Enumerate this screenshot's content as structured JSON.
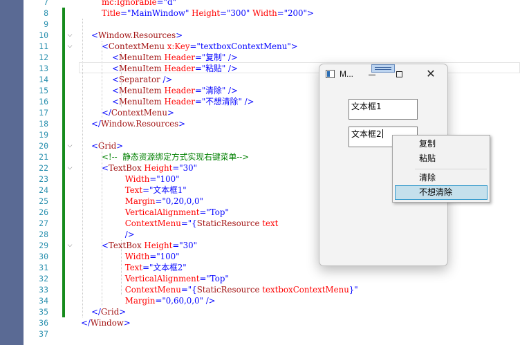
{
  "editor": {
    "line_numbers": [
      "7",
      "8",
      "9",
      "10",
      "11",
      "12",
      "13",
      "14",
      "15",
      "16",
      "17",
      "18",
      "19",
      "20",
      "21",
      "22",
      "23",
      "24",
      "25",
      "26",
      "27",
      "28",
      "29",
      "30",
      "31",
      "32",
      "33",
      "34",
      "35",
      "36",
      "37"
    ],
    "lines": [
      {
        "num": "7",
        "segments": [
          {
            "t": "        ",
            "c": ""
          },
          {
            "t": "mc:Ignorable",
            "c": "attr"
          },
          {
            "t": "=\"d\"",
            "c": "val"
          }
        ]
      },
      {
        "num": "8",
        "segments": [
          {
            "t": "        ",
            "c": ""
          },
          {
            "t": "Title",
            "c": "attr"
          },
          {
            "t": "=\"MainWindow\" ",
            "c": "val"
          },
          {
            "t": "Height",
            "c": "attr"
          },
          {
            "t": "=\"300\" ",
            "c": "val"
          },
          {
            "t": "Width",
            "c": "attr"
          },
          {
            "t": "=\"200\">",
            "c": "val"
          }
        ]
      },
      {
        "num": "9",
        "segments": []
      },
      {
        "num": "10",
        "segments": [
          {
            "t": "    ",
            "c": ""
          },
          {
            "t": "<",
            "c": "bracket"
          },
          {
            "t": "Window.Resources",
            "c": "tag"
          },
          {
            "t": ">",
            "c": "bracket"
          }
        ]
      },
      {
        "num": "11",
        "segments": [
          {
            "t": "        ",
            "c": ""
          },
          {
            "t": "<",
            "c": "bracket"
          },
          {
            "t": "ContextMenu ",
            "c": "tag"
          },
          {
            "t": "x:Key",
            "c": "attr"
          },
          {
            "t": "=\"textboxContextMenu\">",
            "c": "val"
          }
        ]
      },
      {
        "num": "12",
        "segments": [
          {
            "t": "            ",
            "c": ""
          },
          {
            "t": "<",
            "c": "bracket"
          },
          {
            "t": "MenuItem ",
            "c": "tag"
          },
          {
            "t": "Header",
            "c": "attr"
          },
          {
            "t": "=\"复制\" />",
            "c": "val"
          }
        ]
      },
      {
        "num": "13",
        "segments": [
          {
            "t": "            ",
            "c": ""
          },
          {
            "t": "<",
            "c": "bracket"
          },
          {
            "t": "MenuItem ",
            "c": "tag"
          },
          {
            "t": "Header",
            "c": "attr"
          },
          {
            "t": "=\"粘贴\" />",
            "c": "val"
          }
        ]
      },
      {
        "num": "14",
        "segments": [
          {
            "t": "            ",
            "c": ""
          },
          {
            "t": "<",
            "c": "bracket"
          },
          {
            "t": "Separator",
            "c": "tag"
          },
          {
            "t": " />",
            "c": "bracket"
          }
        ]
      },
      {
        "num": "15",
        "segments": [
          {
            "t": "            ",
            "c": ""
          },
          {
            "t": "<",
            "c": "bracket"
          },
          {
            "t": "MenuItem ",
            "c": "tag"
          },
          {
            "t": "Header",
            "c": "attr"
          },
          {
            "t": "=\"清除\" />",
            "c": "val"
          }
        ]
      },
      {
        "num": "16",
        "segments": [
          {
            "t": "            ",
            "c": ""
          },
          {
            "t": "<",
            "c": "bracket"
          },
          {
            "t": "MenuItem ",
            "c": "tag"
          },
          {
            "t": "Header",
            "c": "attr"
          },
          {
            "t": "=\"不想清除\" />",
            "c": "val"
          }
        ]
      },
      {
        "num": "17",
        "segments": [
          {
            "t": "        ",
            "c": ""
          },
          {
            "t": "</",
            "c": "bracket"
          },
          {
            "t": "ContextMenu",
            "c": "tag"
          },
          {
            "t": ">",
            "c": "bracket"
          }
        ]
      },
      {
        "num": "18",
        "segments": [
          {
            "t": "    ",
            "c": ""
          },
          {
            "t": "</",
            "c": "bracket"
          },
          {
            "t": "Window.Resources",
            "c": "tag"
          },
          {
            "t": ">",
            "c": "bracket"
          }
        ]
      },
      {
        "num": "19",
        "segments": []
      },
      {
        "num": "20",
        "segments": [
          {
            "t": "    ",
            "c": ""
          },
          {
            "t": "<",
            "c": "bracket"
          },
          {
            "t": "Grid",
            "c": "tag"
          },
          {
            "t": ">",
            "c": "bracket"
          }
        ]
      },
      {
        "num": "21",
        "segments": [
          {
            "t": "        ",
            "c": ""
          },
          {
            "t": "<!--  静态资源绑定方式实现右键菜单-->",
            "c": "comment"
          }
        ]
      },
      {
        "num": "22",
        "segments": [
          {
            "t": "        ",
            "c": ""
          },
          {
            "t": "<",
            "c": "bracket"
          },
          {
            "t": "TextBox ",
            "c": "tag"
          },
          {
            "t": "Height",
            "c": "attr"
          },
          {
            "t": "=\"30\"",
            "c": "val"
          }
        ]
      },
      {
        "num": "23",
        "segments": [
          {
            "t": "                 ",
            "c": ""
          },
          {
            "t": "Width",
            "c": "attr"
          },
          {
            "t": "=\"100\"",
            "c": "val"
          }
        ]
      },
      {
        "num": "24",
        "segments": [
          {
            "t": "                 ",
            "c": ""
          },
          {
            "t": "Text",
            "c": "attr"
          },
          {
            "t": "=\"文本框1\"",
            "c": "val"
          }
        ]
      },
      {
        "num": "25",
        "segments": [
          {
            "t": "                 ",
            "c": ""
          },
          {
            "t": "Margin",
            "c": "attr"
          },
          {
            "t": "=\"0,20,0,0\"",
            "c": "val"
          }
        ]
      },
      {
        "num": "26",
        "segments": [
          {
            "t": "                 ",
            "c": ""
          },
          {
            "t": "VerticalAlignment",
            "c": "attr"
          },
          {
            "t": "=\"Top\"",
            "c": "val"
          }
        ]
      },
      {
        "num": "27",
        "segments": [
          {
            "t": "                 ",
            "c": ""
          },
          {
            "t": "ContextMenu",
            "c": "attr"
          },
          {
            "t": "=\"{",
            "c": "val"
          },
          {
            "t": "StaticResource ",
            "c": "tag"
          },
          {
            "t": "text",
            "c": "attr"
          }
        ]
      },
      {
        "num": "28",
        "segments": [
          {
            "t": "                 ",
            "c": ""
          },
          {
            "t": "/>",
            "c": "bracket"
          }
        ]
      },
      {
        "num": "29",
        "segments": [
          {
            "t": "        ",
            "c": ""
          },
          {
            "t": "<",
            "c": "bracket"
          },
          {
            "t": "TextBox ",
            "c": "tag"
          },
          {
            "t": "Height",
            "c": "attr"
          },
          {
            "t": "=\"30\"",
            "c": "val"
          }
        ]
      },
      {
        "num": "30",
        "segments": [
          {
            "t": "                 ",
            "c": ""
          },
          {
            "t": "Width",
            "c": "attr"
          },
          {
            "t": "=\"100\"",
            "c": "val"
          }
        ]
      },
      {
        "num": "31",
        "segments": [
          {
            "t": "                 ",
            "c": ""
          },
          {
            "t": "Text",
            "c": "attr"
          },
          {
            "t": "=\"文本框2\"",
            "c": "val"
          }
        ]
      },
      {
        "num": "32",
        "segments": [
          {
            "t": "                 ",
            "c": ""
          },
          {
            "t": "VerticalAlignment",
            "c": "attr"
          },
          {
            "t": "=\"Top\"",
            "c": "val"
          }
        ]
      },
      {
        "num": "33",
        "segments": [
          {
            "t": "                 ",
            "c": ""
          },
          {
            "t": "ContextMenu",
            "c": "attr"
          },
          {
            "t": "=\"{",
            "c": "val"
          },
          {
            "t": "StaticResource ",
            "c": "tag"
          },
          {
            "t": "textboxContextMenu",
            "c": "attr"
          },
          {
            "t": "}\"",
            "c": "val"
          }
        ]
      },
      {
        "num": "34",
        "segments": [
          {
            "t": "                 ",
            "c": ""
          },
          {
            "t": "Margin",
            "c": "attr"
          },
          {
            "t": "=\"0,60,0,0\" />",
            "c": "val"
          }
        ]
      },
      {
        "num": "35",
        "segments": [
          {
            "t": "    ",
            "c": ""
          },
          {
            "t": "</",
            "c": "bracket"
          },
          {
            "t": "Grid",
            "c": "tag"
          },
          {
            "t": ">",
            "c": "bracket"
          }
        ]
      },
      {
        "num": "36",
        "segments": [
          {
            "t": "</",
            "c": "bracket"
          },
          {
            "t": "Window",
            "c": "tag"
          },
          {
            "t": ">",
            "c": "bracket"
          }
        ]
      },
      {
        "num": "37",
        "segments": []
      }
    ],
    "fold_markers": [
      "10",
      "11",
      "20",
      "22",
      "29"
    ],
    "colors": {
      "tag": "#a31515",
      "attribute": "#ff0000",
      "value": "#0000ff",
      "comment": "#008000",
      "line_number": "#2b91af",
      "change_bar": "#168b1c"
    }
  },
  "app_window": {
    "title": "M...",
    "icons": {
      "app": "app-window-icon",
      "minimize": "minimize-icon",
      "maximize": "maximize-icon",
      "close": "close-icon"
    },
    "close_glyph": "✕",
    "textbox1": {
      "text": "文本框1"
    },
    "textbox2": {
      "text": "文本框2"
    }
  },
  "context_menu": {
    "items": [
      {
        "label": "复制",
        "highlighted": false
      },
      {
        "label": "粘贴",
        "highlighted": false
      },
      {
        "separator": true
      },
      {
        "label": "清除",
        "highlighted": false
      },
      {
        "label": "不想清除",
        "highlighted": true
      }
    ],
    "highlight_color": "#c5e0ec"
  }
}
